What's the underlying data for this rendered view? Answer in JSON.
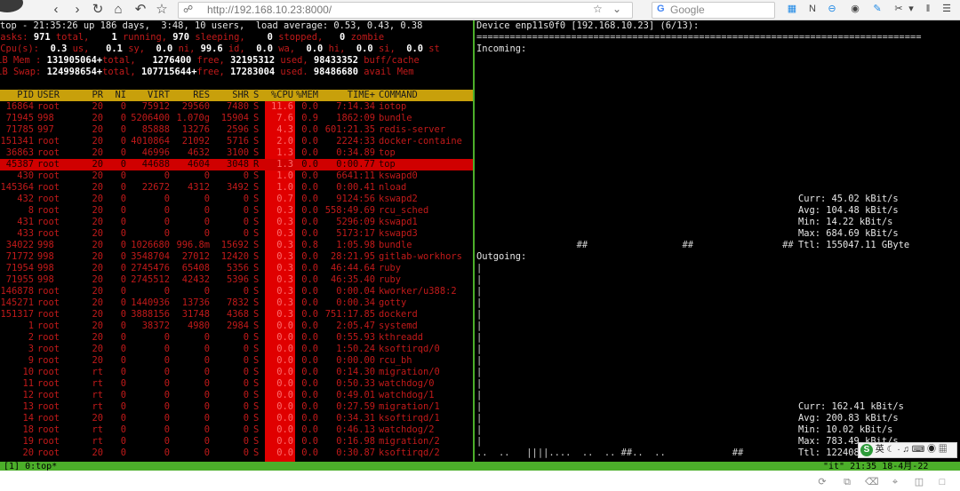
{
  "browser": {
    "url": "http://192.168.10.23:8000/",
    "search_placeholder": "Google",
    "search_engine_icon": "G",
    "nav_icons": [
      "back-icon",
      "forward-icon",
      "reload-icon",
      "home-icon",
      "undo-icon",
      "bookmark-star-icon"
    ]
  },
  "top": {
    "summary": "top - 21:35:26 up 186 days,  3:48, 10 users,  load average: 0.53, 0.43, 0.38",
    "tasks": {
      "label": "Tasks:",
      "total": "971",
      "total_label": "total,",
      "running": "1",
      "running_label": "running,",
      "sleeping": "970",
      "sleeping_label": "sleeping,",
      "stopped": "0",
      "stopped_label": "stopped,",
      "zombie": "0",
      "zombie_label": "zombie"
    },
    "cpu": {
      "label": "%Cpu(s):",
      "us": "0.3",
      "us_l": "us,",
      "sy": "0.1",
      "sy_l": "sy,",
      "ni": "0.0",
      "ni_l": "ni,",
      "id": "99.6",
      "id_l": "id,",
      "wa": "0.0",
      "wa_l": "wa,",
      "hi": "0.0",
      "hi_l": "hi,",
      "si": "0.0",
      "si_l": "si,",
      "st": "0.0",
      "st_l": "st"
    },
    "mem": {
      "label": "KiB Mem :",
      "total": "131905064+",
      "total_l": "total,",
      "free": "1276400",
      "free_l": "free,",
      "used": "32195312",
      "used_l": "used,",
      "buff": "98433352",
      "buff_l": "buff/cache"
    },
    "swap": {
      "label": "KiB Swap:",
      "total": "124998654+",
      "total_l": "total,",
      "free": "107715644+",
      "free_l": "free,",
      "used": "17283004",
      "used_l": "used.",
      "avail": "98486680",
      "avail_l": "avail Mem"
    },
    "columns": [
      "PID",
      "USER",
      "PR",
      "NI",
      "VIRT",
      "RES",
      "SHR",
      "S",
      "%CPU",
      "%MEM",
      "TIME+",
      "COMMAND"
    ],
    "processes": [
      [
        "16864",
        "root",
        "20",
        "0",
        "75912",
        "29560",
        "7480",
        "S",
        "11.6",
        "0.0",
        "7:14.34",
        "iotop"
      ],
      [
        "71945",
        "998",
        "20",
        "0",
        "5206400",
        "1.070g",
        "15904",
        "S",
        "7.6",
        "0.9",
        "1862:09",
        "bundle"
      ],
      [
        "71785",
        "997",
        "20",
        "0",
        "85888",
        "13276",
        "2596",
        "S",
        "4.3",
        "0.0",
        "601:21.35",
        "redis-server"
      ],
      [
        "151341",
        "root",
        "20",
        "0",
        "4010864",
        "21092",
        "5716",
        "S",
        "2.0",
        "0.0",
        "2224:33",
        "docker-containe"
      ],
      [
        "36863",
        "root",
        "20",
        "0",
        "46996",
        "4632",
        "3100",
        "S",
        "1.3",
        "0.0",
        "0:34.89",
        "top"
      ],
      [
        "45387",
        "root",
        "20",
        "0",
        "44688",
        "4604",
        "3048",
        "R",
        "1.3",
        "0.0",
        "0:00.77",
        "top"
      ],
      [
        "430",
        "root",
        "20",
        "0",
        "0",
        "0",
        "0",
        "S",
        "1.0",
        "0.0",
        "6641:11",
        "kswapd0"
      ],
      [
        "145364",
        "root",
        "20",
        "0",
        "22672",
        "4312",
        "3492",
        "S",
        "1.0",
        "0.0",
        "0:00.41",
        "nload"
      ],
      [
        "432",
        "root",
        "20",
        "0",
        "0",
        "0",
        "0",
        "S",
        "0.7",
        "0.0",
        "9124:56",
        "kswapd2"
      ],
      [
        "8",
        "root",
        "20",
        "0",
        "0",
        "0",
        "0",
        "S",
        "0.3",
        "0.0",
        "558:49.69",
        "rcu_sched"
      ],
      [
        "431",
        "root",
        "20",
        "0",
        "0",
        "0",
        "0",
        "S",
        "0.3",
        "0.0",
        "5296:09",
        "kswapd1"
      ],
      [
        "433",
        "root",
        "20",
        "0",
        "0",
        "0",
        "0",
        "S",
        "0.3",
        "0.0",
        "5173:17",
        "kswapd3"
      ],
      [
        "34022",
        "998",
        "20",
        "0",
        "1026680",
        "996.8m",
        "15692",
        "S",
        "0.3",
        "0.8",
        "1:05.98",
        "bundle"
      ],
      [
        "71772",
        "998",
        "20",
        "0",
        "3548704",
        "27012",
        "12420",
        "S",
        "0.3",
        "0.0",
        "28:21.95",
        "gitlab-workhors"
      ],
      [
        "71954",
        "998",
        "20",
        "0",
        "2745476",
        "65408",
        "5356",
        "S",
        "0.3",
        "0.0",
        "46:44.64",
        "ruby"
      ],
      [
        "71955",
        "998",
        "20",
        "0",
        "2745512",
        "42432",
        "5396",
        "S",
        "0.3",
        "0.0",
        "46:35.40",
        "ruby"
      ],
      [
        "146878",
        "root",
        "20",
        "0",
        "0",
        "0",
        "0",
        "S",
        "0.3",
        "0.0",
        "0:00.04",
        "kworker/u388:2"
      ],
      [
        "145271",
        "root",
        "20",
        "0",
        "1440936",
        "13736",
        "7832",
        "S",
        "0.3",
        "0.0",
        "0:00.34",
        "gotty"
      ],
      [
        "151317",
        "root",
        "20",
        "0",
        "3888156",
        "31748",
        "4368",
        "S",
        "0.3",
        "0.0",
        "751:17.85",
        "dockerd"
      ],
      [
        "1",
        "root",
        "20",
        "0",
        "38372",
        "4980",
        "2984",
        "S",
        "0.0",
        "0.0",
        "2:05.47",
        "systemd"
      ],
      [
        "2",
        "root",
        "20",
        "0",
        "0",
        "0",
        "0",
        "S",
        "0.0",
        "0.0",
        "0:55.93",
        "kthreadd"
      ],
      [
        "3",
        "root",
        "20",
        "0",
        "0",
        "0",
        "0",
        "S",
        "0.0",
        "0.0",
        "1:50.24",
        "ksoftirqd/0"
      ],
      [
        "9",
        "root",
        "20",
        "0",
        "0",
        "0",
        "0",
        "S",
        "0.0",
        "0.0",
        "0:00.00",
        "rcu_bh"
      ],
      [
        "10",
        "root",
        "rt",
        "0",
        "0",
        "0",
        "0",
        "S",
        "0.0",
        "0.0",
        "0:14.30",
        "migration/0"
      ],
      [
        "11",
        "root",
        "rt",
        "0",
        "0",
        "0",
        "0",
        "S",
        "0.0",
        "0.0",
        "0:50.33",
        "watchdog/0"
      ],
      [
        "12",
        "root",
        "rt",
        "0",
        "0",
        "0",
        "0",
        "S",
        "0.0",
        "0.0",
        "0:49.01",
        "watchdog/1"
      ],
      [
        "13",
        "root",
        "rt",
        "0",
        "0",
        "0",
        "0",
        "S",
        "0.0",
        "0.0",
        "0:27.59",
        "migration/1"
      ],
      [
        "14",
        "root",
        "20",
        "0",
        "0",
        "0",
        "0",
        "S",
        "0.0",
        "0.0",
        "0:34.31",
        "ksoftirqd/1"
      ],
      [
        "18",
        "root",
        "rt",
        "0",
        "0",
        "0",
        "0",
        "S",
        "0.0",
        "0.0",
        "0:46.13",
        "watchdog/2"
      ],
      [
        "19",
        "root",
        "rt",
        "0",
        "0",
        "0",
        "0",
        "S",
        "0.0",
        "0.0",
        "0:16.98",
        "migration/2"
      ],
      [
        "20",
        "root",
        "20",
        "0",
        "0",
        "0",
        "0",
        "S",
        "0.0",
        "0.0",
        "0:30.87",
        "ksoftirqd/2"
      ]
    ]
  },
  "nload": {
    "device": "Device enp11s0f0 [192.168.10.23] (6/13):",
    "separator": "================================================================================",
    "incoming_label": "Incoming:",
    "incoming_stats": [
      "Curr: 45.02 kBit/s",
      "Avg: 104.48 kBit/s",
      "Min: 14.22 kBit/s",
      "Max: 684.69 kBit/s",
      "Ttl: 155047.11 GByte"
    ],
    "incoming_bars": "                  ##                 ##                ##",
    "outgoing_label": "Outgoing:",
    "outgoing_stats": [
      "Curr: 162.41 kBit/s",
      "Avg: 200.83 kBit/s",
      "Min: 10.02 kBit/s",
      "Max: 783.49 kBit/s",
      "Ttl: 122408"
    ],
    "outgoing_bars": "..  ..   ||||....  ..  .. ##..  ..            ##"
  },
  "status": {
    "left": "[1] 0:top*",
    "right": "\"it\" 21:35 18-4月-22"
  },
  "ime": {
    "label": "英",
    "icons": [
      "moon-icon",
      "dot-icon",
      "microphone-icon",
      "keyboard-icon",
      "shirt-icon",
      "grid-icon"
    ]
  }
}
